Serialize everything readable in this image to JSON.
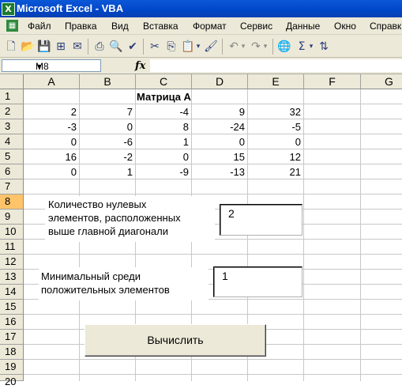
{
  "window": {
    "title": "Microsoft Excel - VBA",
    "app_icon": "X"
  },
  "menu": {
    "items": [
      "Файл",
      "Правка",
      "Вид",
      "Вставка",
      "Формат",
      "Сервис",
      "Данные",
      "Окно",
      "Справка"
    ]
  },
  "formula_bar": {
    "name_box": "M8",
    "fx": "fx",
    "formula": ""
  },
  "sheet": {
    "columns": [
      "A",
      "B",
      "C",
      "D",
      "E",
      "F",
      "G"
    ],
    "rows": [
      "1",
      "2",
      "3",
      "4",
      "5",
      "6",
      "7",
      "8",
      "9",
      "10",
      "11",
      "12",
      "13",
      "14",
      "15",
      "16",
      "17",
      "18",
      "19",
      "20"
    ],
    "selected_rows": [
      "8"
    ],
    "matrix_title": "Матрица А",
    "matrix": [
      [
        "2",
        "7",
        "-4",
        "9",
        "32"
      ],
      [
        "-3",
        "0",
        "8",
        "-24",
        "-5"
      ],
      [
        "0",
        "-6",
        "1",
        "0",
        "0"
      ],
      [
        "16",
        "-2",
        "0",
        "15",
        "12"
      ],
      [
        "0",
        "1",
        "-9",
        "-13",
        "21"
      ]
    ]
  },
  "controls": {
    "label1": [
      "Количество нулевых",
      "элементов, расположенных",
      "выше главной диагонали"
    ],
    "textbox1": "2",
    "label2": [
      "Минимальный среди",
      "положительных элементов"
    ],
    "textbox2": "1",
    "calc_button": "Вычислить"
  }
}
